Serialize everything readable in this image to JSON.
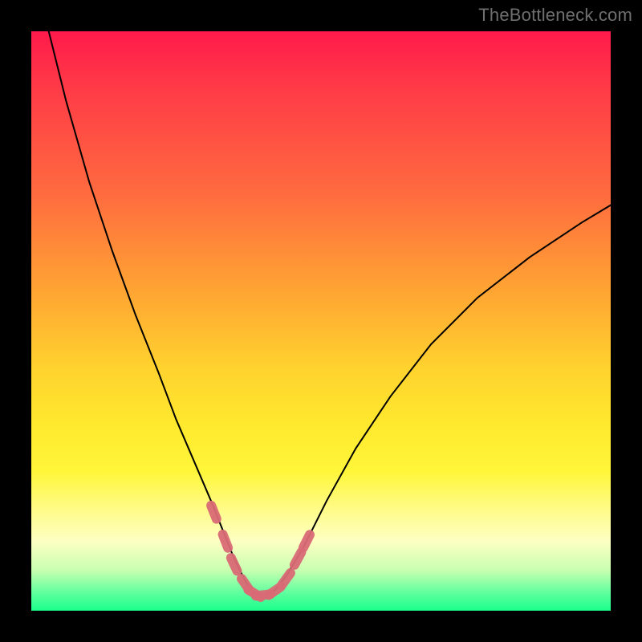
{
  "watermark": "TheBottleneck.com",
  "colors": {
    "background": "#000000",
    "gradient_top": "#ff1a4b",
    "gradient_bottom": "#1aff8a",
    "curve": "#000000",
    "marker": "#d96a75"
  },
  "chart_data": {
    "type": "line",
    "title": "",
    "xlabel": "",
    "ylabel": "",
    "xlim": [
      0,
      100
    ],
    "ylim": [
      0,
      100
    ],
    "grid": false,
    "legend": false,
    "series": [
      {
        "name": "bottleneck-curve",
        "x": [
          3,
          6,
          10,
          14,
          18,
          22,
          25,
          28,
          31,
          33,
          35,
          37,
          38.5,
          40,
          42,
          44,
          47,
          51,
          56,
          62,
          69,
          77,
          86,
          95,
          100
        ],
        "y": [
          100,
          88,
          74,
          62,
          51,
          41,
          33,
          26,
          19,
          14,
          9,
          5,
          3,
          2.5,
          3.5,
          6,
          11,
          19,
          28,
          37,
          46,
          54,
          61,
          67,
          70
        ]
      }
    ],
    "markers": {
      "name": "highlight-points-near-minimum",
      "color": "#d96a75",
      "points_x": [
        31.5,
        33.5,
        35,
        37,
        38.5,
        40,
        42,
        44,
        46,
        47.5
      ],
      "points_y": [
        17,
        12,
        8,
        4.5,
        3,
        2.7,
        3.4,
        5.5,
        9,
        12
      ]
    },
    "minimum": {
      "x": 40,
      "y": 2.5
    }
  }
}
